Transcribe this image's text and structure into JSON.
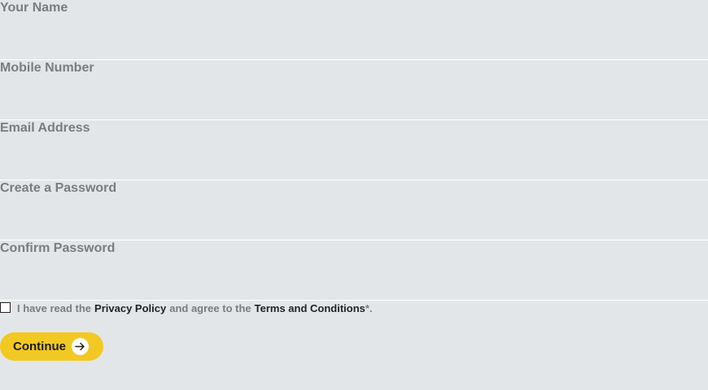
{
  "form": {
    "fields": [
      {
        "label": "Your Name",
        "value": "",
        "type": "text"
      },
      {
        "label": "Mobile Number",
        "value": "",
        "type": "tel"
      },
      {
        "label": "Email Address",
        "value": "",
        "type": "email"
      },
      {
        "label": "Create a Password",
        "value": "",
        "type": "password"
      },
      {
        "label": "Confirm Password",
        "value": "",
        "type": "password"
      }
    ]
  },
  "consent": {
    "checked": false,
    "text_before": "I have read the",
    "privacy_link": "Privacy Policy",
    "text_middle": "and agree to the",
    "terms_link": "Terms and Conditions",
    "required_mark": "*.",
    "link_color": "#1f2124",
    "text_color": "#7a7d80"
  },
  "continue_button": {
    "label": "Continue",
    "icon": "arrow-right-icon",
    "color": "#f2c923"
  },
  "colors": {
    "background": "#e3e6e8",
    "divider": "#ffffff",
    "label": "#7a7d80"
  }
}
